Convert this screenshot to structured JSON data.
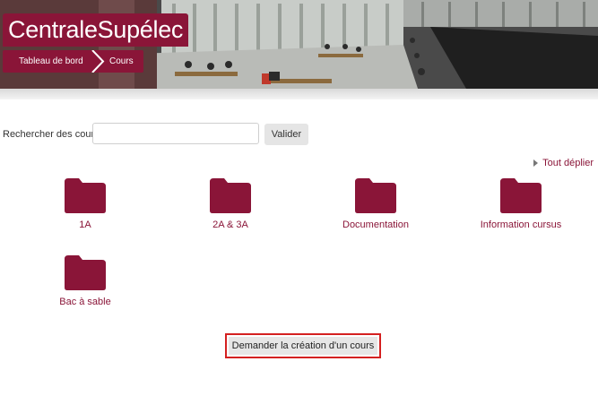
{
  "header": {
    "brand": "CentraleSupélec",
    "breadcrumb": [
      "Tableau de bord",
      "Cours"
    ]
  },
  "search": {
    "label": "Rechercher des cours",
    "value": "",
    "placeholder": "",
    "button": "Valider"
  },
  "expand_all": "Tout déplier",
  "categories": [
    {
      "label": "1A",
      "icon": "folder-icon"
    },
    {
      "label": "2A & 3A",
      "icon": "folder-icon"
    },
    {
      "label": "Documentation",
      "icon": "folder-icon"
    },
    {
      "label": "Information cursus",
      "icon": "folder-icon"
    },
    {
      "label": "Bac à sable",
      "icon": "folder-icon"
    }
  ],
  "request_button": "Demander la création d'un cours",
  "colors": {
    "brand": "#8a1538",
    "highlight": "#d42020",
    "button_bg": "#e5e5e5"
  }
}
